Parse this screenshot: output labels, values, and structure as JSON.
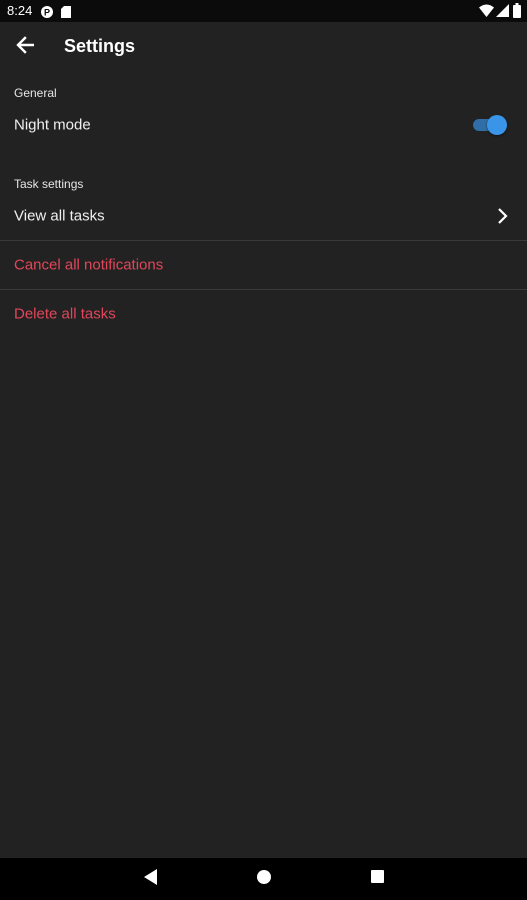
{
  "status_bar": {
    "time": "8:24",
    "icons": [
      "p-circle-icon",
      "sd-card-icon",
      "wifi-icon",
      "signal-icon",
      "battery-icon"
    ]
  },
  "app_bar": {
    "title": "Settings",
    "back_icon": "arrow-left-icon"
  },
  "sections": {
    "general": {
      "header": "General",
      "night_mode": {
        "label": "Night mode",
        "enabled": true,
        "accent_color": "#3a95e8"
      }
    },
    "task_settings": {
      "header": "Task settings",
      "view_all_tasks": {
        "label": "View all tasks",
        "icon": "chevron-right-icon"
      },
      "cancel_all_notifications": {
        "label": "Cancel all notifications",
        "color": "#e0475a"
      },
      "delete_all_tasks": {
        "label": "Delete all tasks",
        "color": "#e0475a"
      }
    }
  },
  "nav_bar": {
    "buttons": [
      "back-triangle-icon",
      "home-circle-icon",
      "recents-square-icon"
    ]
  },
  "colors": {
    "background": "#222222",
    "text": "#f0f0f0",
    "danger": "#e0475a",
    "accent": "#3a95e8"
  }
}
